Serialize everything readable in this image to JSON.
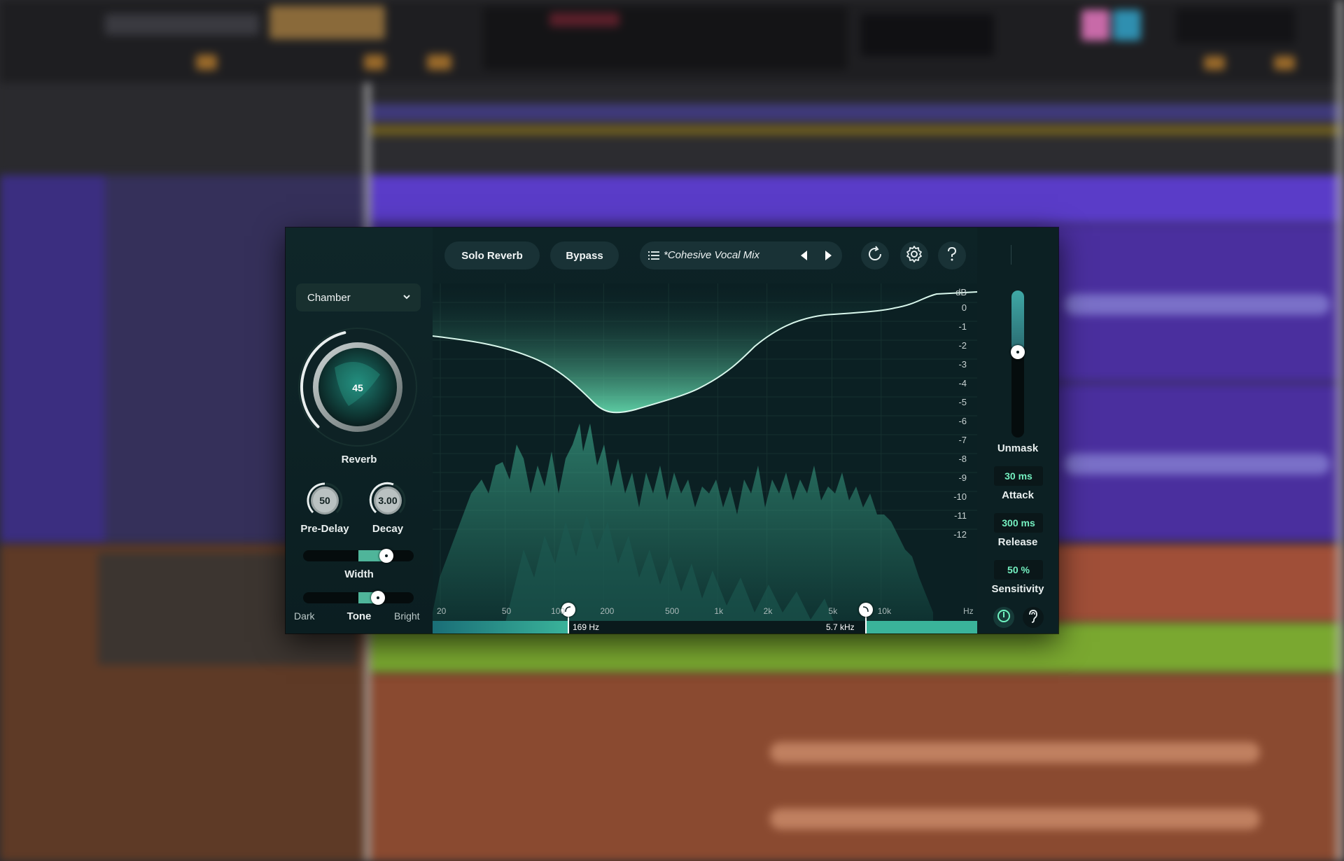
{
  "plugin": {
    "mode_dropdown": {
      "value": "Chamber"
    },
    "header": {
      "solo_reverb_label": "Solo Reverb",
      "bypass_label": "Bypass",
      "preset_name": "*Cohesive Vocal Mix",
      "icons": [
        "list-icon",
        "arrow-left-icon",
        "arrow-right-icon",
        "loop-icon",
        "gear-icon",
        "help-icon"
      ]
    },
    "reverb_knob": {
      "value": "45",
      "label": "Reverb",
      "level": 0.45
    },
    "pre_delay": {
      "value": "50",
      "label": "Pre-Delay"
    },
    "decay": {
      "value": "3.00",
      "label": "Decay"
    },
    "width": {
      "label": "Width",
      "level": 0.75
    },
    "tone": {
      "label": "Tone",
      "dark_label": "Dark",
      "bright_label": "Bright",
      "level": 0.68
    },
    "spectrum": {
      "db_unit": "dB",
      "db_ticks": [
        "0",
        "-1",
        "-2",
        "-3",
        "-4",
        "-5",
        "-6",
        "-7",
        "-8",
        "-9",
        "-10",
        "-11",
        "-12"
      ],
      "freq_ticks": [
        "20",
        "50",
        "100",
        "200",
        "500",
        "1k",
        "2k",
        "5k",
        "10k"
      ],
      "freq_unit": "Hz",
      "low_cut_label": "169 Hz",
      "high_cut_label": "5.7 kHz",
      "accent_color": "#6ff3c0"
    },
    "unmask": {
      "label": "Unmask",
      "level": 0.58,
      "attack": {
        "value": "30 ms",
        "label": "Attack"
      },
      "release": {
        "value": "300 ms",
        "label": "Release"
      },
      "sensitivity": {
        "value": "50 %",
        "label": "Sensitivity"
      },
      "icons": [
        "power-icon",
        "ear-icon"
      ]
    }
  }
}
